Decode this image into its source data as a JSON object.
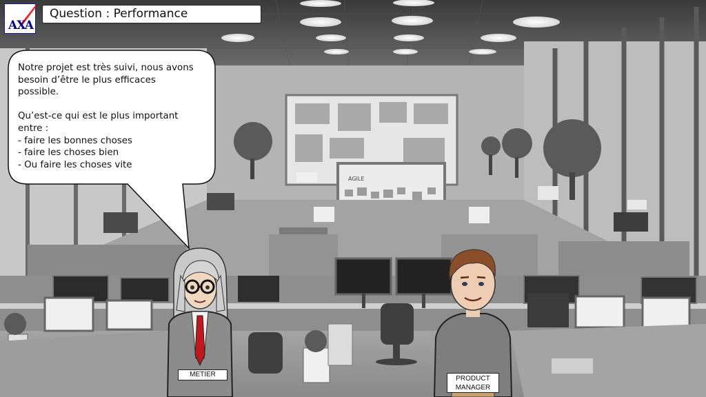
{
  "title": "Question : Performance",
  "logo": {
    "text": "AXA",
    "brand_color": "#00008f",
    "accent_color": "#ff1721"
  },
  "dialogue": {
    "speaker": "METIER",
    "lines": [
      "Notre projet est très suivi, nous avons",
      "besoin d’être le plus efficaces",
      "possible.",
      "",
      "Qu’est-ce qui est le plus important",
      "entre :",
      "- faire les bonnes choses",
      "- faire les choses bien",
      "- Ou faire les choses vite"
    ]
  },
  "characters": {
    "metier": {
      "label": "METIER"
    },
    "product_manager": {
      "label_line1": "PRODUCT",
      "label_line2": "MANAGER"
    }
  },
  "board_text": "AGILE"
}
